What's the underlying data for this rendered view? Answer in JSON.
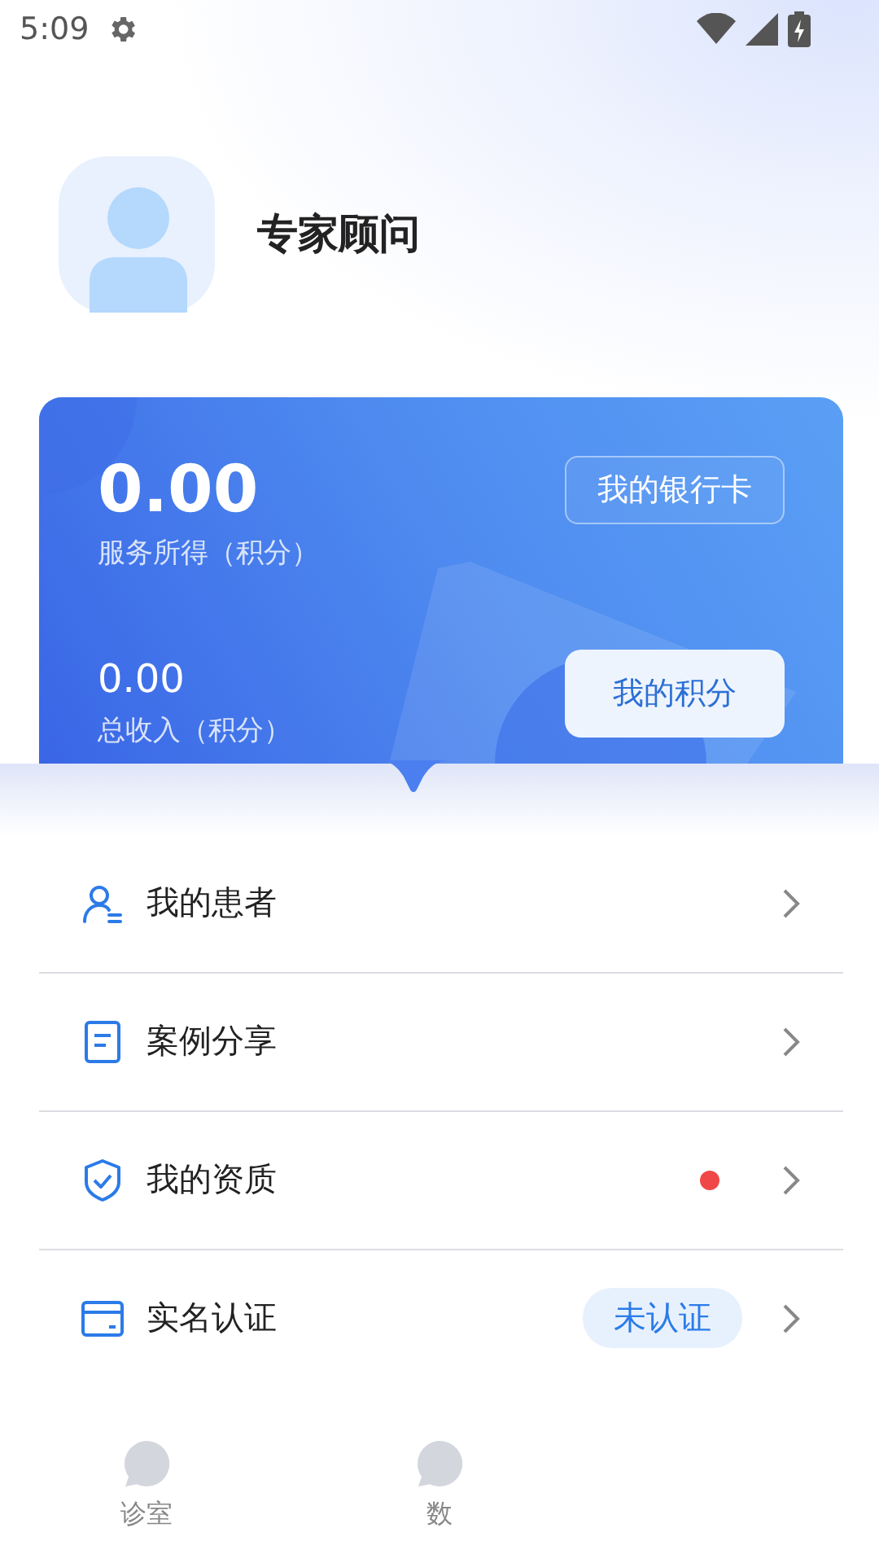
{
  "status_bar": {
    "time": "5:09"
  },
  "profile": {
    "name": "专家顾问"
  },
  "wallet": {
    "service_amount": "0.00",
    "service_label": "服务所得（积分）",
    "total_amount": "0.00",
    "total_label": "总收入（积分）",
    "bank_button": "我的银行卡",
    "points_button": "我的积分"
  },
  "menu": [
    {
      "kind": "patients",
      "label": "我的患者",
      "dot": false
    },
    {
      "kind": "cases",
      "label": "案例分享",
      "dot": false
    },
    {
      "kind": "qualification",
      "label": "我的资质",
      "dot": true
    },
    {
      "kind": "identity",
      "label": "实名认证",
      "dot": false,
      "badge": "未认证"
    }
  ],
  "tabs": [
    {
      "label": "诊室",
      "selected": false
    },
    {
      "label": "数",
      "selected": false
    }
  ]
}
